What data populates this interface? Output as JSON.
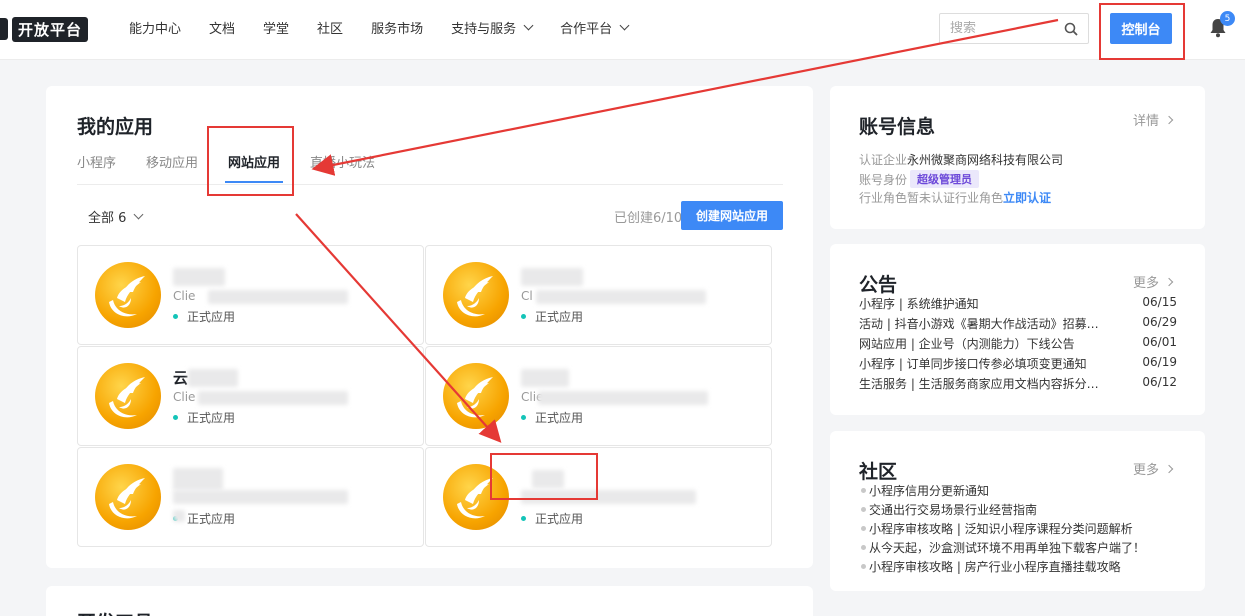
{
  "header": {
    "logo_text": "开放平台",
    "nav": [
      {
        "label": "能力中心",
        "dropdown": false
      },
      {
        "label": "文档",
        "dropdown": false
      },
      {
        "label": "学堂",
        "dropdown": false
      },
      {
        "label": "社区",
        "dropdown": false
      },
      {
        "label": "服务市场",
        "dropdown": false
      },
      {
        "label": "支持与服务",
        "dropdown": true
      },
      {
        "label": "合作平台",
        "dropdown": true
      }
    ],
    "search_placeholder": "搜索",
    "console_label": "控制台",
    "notification_count": "5"
  },
  "apps": {
    "title": "我的应用",
    "tabs": [
      "小程序",
      "移动应用",
      "网站应用",
      "直播小玩法"
    ],
    "active_tab": 2,
    "filter_label": "全部 6",
    "created_label": "已创建6/10",
    "create_button": "创建网站应用",
    "items": [
      {
        "name": "",
        "client": "Clie",
        "status": "正式应用"
      },
      {
        "name": "",
        "client": "Cl",
        "status": "正式应用"
      },
      {
        "name": "云",
        "client": "Clie",
        "status": "正式应用"
      },
      {
        "name": "",
        "client": "Clie",
        "status": "正式应用"
      },
      {
        "name": "",
        "client": "",
        "status": "正式应用"
      },
      {
        "name": "",
        "client": "",
        "status": "正式应用"
      }
    ]
  },
  "bottom_card": {
    "title": "开发工具"
  },
  "account": {
    "title": "账号信息",
    "detail_label": "详情",
    "verified_label": "认证企业",
    "verified_value": "永州微聚商网络科技有限公司",
    "identity_label": "账号身份",
    "identity_badge": "超级管理员",
    "industry_label": "行业角色",
    "industry_value": "暂未认证行业角色",
    "verify_link": "立即认证"
  },
  "notices": {
    "title": "公告",
    "more_label": "更多",
    "items": [
      {
        "text": "小程序 | 系统维护通知",
        "date": "06/15"
      },
      {
        "text": "活动 | 抖音小游戏《暑期大作战活动》招募…",
        "date": "06/29"
      },
      {
        "text": "网站应用 | 企业号（内测能力）下线公告",
        "date": "06/01"
      },
      {
        "text": "小程序 | 订单同步接口传参必填项变更通知",
        "date": "06/19"
      },
      {
        "text": "生活服务 | 生活服务商家应用文档内容拆分…",
        "date": "06/12"
      }
    ]
  },
  "community": {
    "title": "社区",
    "more_label": "更多",
    "items": [
      "小程序信用分更新通知",
      "交通出行交易场景行业经营指南",
      "小程序审核攻略 | 泛知识小程序课程分类问题解析",
      "从今天起，沙盒测试环境不用再单独下载客户端了！",
      "小程序审核攻略 | 房产行业小程序直播挂载攻略"
    ]
  },
  "colors": {
    "accent": "#3d89f6",
    "annotation": "#e53935",
    "status_dot": "#14c4b8"
  }
}
